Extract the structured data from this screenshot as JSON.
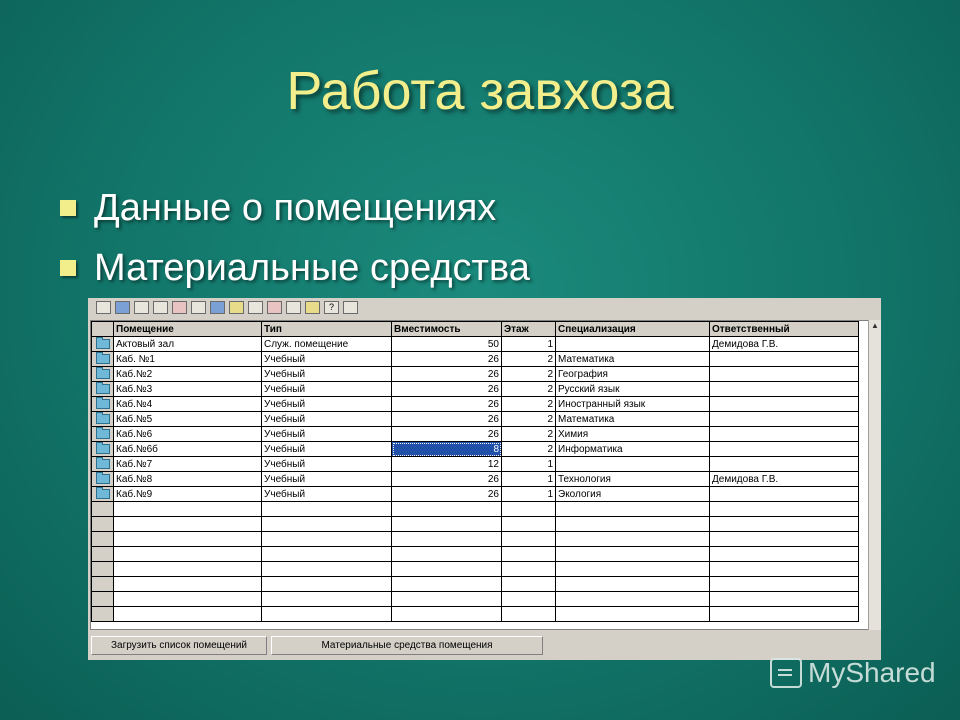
{
  "slide": {
    "title": "Работа завхоза",
    "bullets": [
      "Данные о помещениях",
      "Материальные средства"
    ]
  },
  "toolbar": {
    "icons": [
      "new-record-icon",
      "save-icon",
      "edit-icon",
      "print-icon",
      "delete-icon",
      "copy-icon",
      "move-icon",
      "filter-icon",
      "lock-icon",
      "cut-icon",
      "find-icon",
      "export-icon",
      "help-icon",
      "pointer-icon"
    ]
  },
  "grid": {
    "columns": [
      "Помещение",
      "Тип",
      "Вместимость",
      "Этаж",
      "Специализация",
      "Ответственный"
    ],
    "rows": [
      [
        "Актовый зал",
        "Служ. помещение",
        "50",
        "1",
        "",
        "Демидова Г.В."
      ],
      [
        "Каб. №1",
        "Учебный",
        "26",
        "2",
        "Математика",
        ""
      ],
      [
        "Каб.№2",
        "Учебный",
        "26",
        "2",
        "География",
        ""
      ],
      [
        "Каб.№3",
        "Учебный",
        "26",
        "2",
        "Русский язык",
        ""
      ],
      [
        "Каб.№4",
        "Учебный",
        "26",
        "2",
        "Иностранный язык",
        ""
      ],
      [
        "Каб.№5",
        "Учебный",
        "26",
        "2",
        "Математика",
        ""
      ],
      [
        "Каб.№6",
        "Учебный",
        "26",
        "2",
        "Химия",
        ""
      ],
      [
        "Каб.№6б",
        "Учебный",
        "8",
        "2",
        "Информатика",
        ""
      ],
      [
        "Каб.№7",
        "Учебный",
        "12",
        "1",
        "",
        ""
      ],
      [
        "Каб.№8",
        "Учебный",
        "26",
        "1",
        "Технология",
        "Демидова Г.В."
      ],
      [
        "Каб.№9",
        "Учебный",
        "26",
        "1",
        "Экология",
        ""
      ]
    ],
    "selected": {
      "row": 7,
      "col": 2
    },
    "empty_rows": 8
  },
  "buttons": {
    "load_rooms": "Загрузить список помещений",
    "room_assets": "Материальные средства помещения"
  },
  "watermark": {
    "text": "MyShared"
  }
}
